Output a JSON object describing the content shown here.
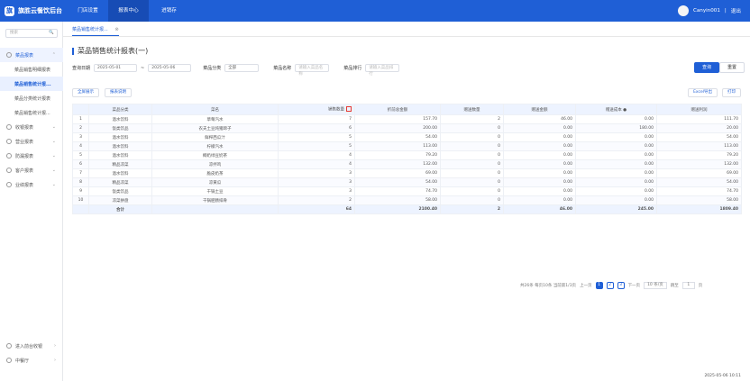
{
  "app": {
    "title": "旗胜云餐饮后台",
    "nav": [
      "门店设置",
      "报表中心",
      "进销存"
    ],
    "active_nav": 1,
    "user": "Canyin001",
    "separator": "|",
    "logout": "退出"
  },
  "sidebar": {
    "search_placeholder": "搜索",
    "search_icon": "🔍",
    "groups": [
      {
        "label": "菜品报表",
        "open": true
      },
      {
        "label": "收银报表",
        "open": false
      },
      {
        "label": "营业报表",
        "open": false
      },
      {
        "label": "防漏报表",
        "open": false
      },
      {
        "label": "客户报表",
        "open": false
      },
      {
        "label": "业绩报表",
        "open": false
      }
    ],
    "submenu": [
      "菜品销售明细报表",
      "菜品销售统计报...",
      "菜品分类统计报表",
      "菜品销售统计报..."
    ],
    "active_submenu": 1,
    "bottom": [
      "进入前台收银",
      "中餐厅"
    ]
  },
  "tab": {
    "label": "菜品销售统计报...",
    "close": "⊗"
  },
  "page": {
    "title": "菜品销售统计报表(一)",
    "filters": {
      "date_label": "查询日期",
      "start_date": "2025-05-01",
      "separator": "~",
      "end_date": "2025-05-06",
      "category_label": "菜品分类",
      "category_value": "全部",
      "name_label": "菜品名称",
      "name_placeholder": "请输入菜品名称",
      "rank_label": "菜品排行",
      "rank_placeholder": "请输入菜品排行"
    },
    "buttons": {
      "query": "查询",
      "reset": "重置",
      "expand": "全屏展示",
      "chart": "报表说明",
      "export": "Excel导出",
      "print": "打印"
    },
    "columns": [
      "",
      "菜品分类",
      "菜名",
      "销售数量",
      "折前总金额",
      "赠送数量",
      "赠送金额",
      "赠送成本",
      "赠送利润"
    ],
    "rows": [
      [
        "1",
        "酒水饮料",
        "草莓汽水",
        "7",
        "157.70",
        "2",
        "46.00",
        "0.00",
        "111.70"
      ],
      [
        "2",
        "饭类饮品",
        "农夫土豆炖猪蹄子",
        "6",
        "200.00",
        "0",
        "0.00",
        "180.00",
        "20.00"
      ],
      [
        "3",
        "酒水饮料",
        "鲜榨西瓜汁",
        "5",
        "54.00",
        "0",
        "0.00",
        "0.00",
        "54.00"
      ],
      [
        "4",
        "酒水饮料",
        "柠檬汽水",
        "5",
        "113.00",
        "0",
        "0.00",
        "0.00",
        "113.00"
      ],
      [
        "5",
        "酒水饮料",
        "椰奶绿豆奶茶",
        "4",
        "79.20",
        "0",
        "0.00",
        "0.00",
        "79.20"
      ],
      [
        "6",
        "精品凉菜",
        "凉拌鸡",
        "4",
        "132.00",
        "0",
        "0.00",
        "0.00",
        "132.00"
      ],
      [
        "7",
        "酒水饮料",
        "脆皮奶茶",
        "3",
        "69.00",
        "0",
        "0.00",
        "0.00",
        "69.00"
      ],
      [
        "8",
        "精品凉菜",
        "凉黄瓜",
        "3",
        "54.00",
        "0",
        "0.00",
        "0.00",
        "54.00"
      ],
      [
        "9",
        "饭类饮品",
        "干锅土豆",
        "3",
        "74.70",
        "0",
        "0.00",
        "0.00",
        "74.70"
      ],
      [
        "10",
        "凉菜拼盘",
        "干锅肥肠排骨",
        "2",
        "58.00",
        "0",
        "0.00",
        "0.00",
        "58.00"
      ]
    ],
    "total": [
      "",
      "合计",
      "",
      "64",
      "2100.40",
      "2",
      "46.00",
      "245.00",
      "1809.40"
    ],
    "pagination": {
      "summary": "共26条 每页10条 当前第1/3页",
      "prev": "上一页",
      "pages": [
        "1",
        "2",
        "3"
      ],
      "next": "下一页",
      "page_size": "10 条/页",
      "jump_label": "跳至",
      "jump_value": "1",
      "page_unit": "页"
    }
  },
  "footer_time": "2025-05-06 10:11"
}
